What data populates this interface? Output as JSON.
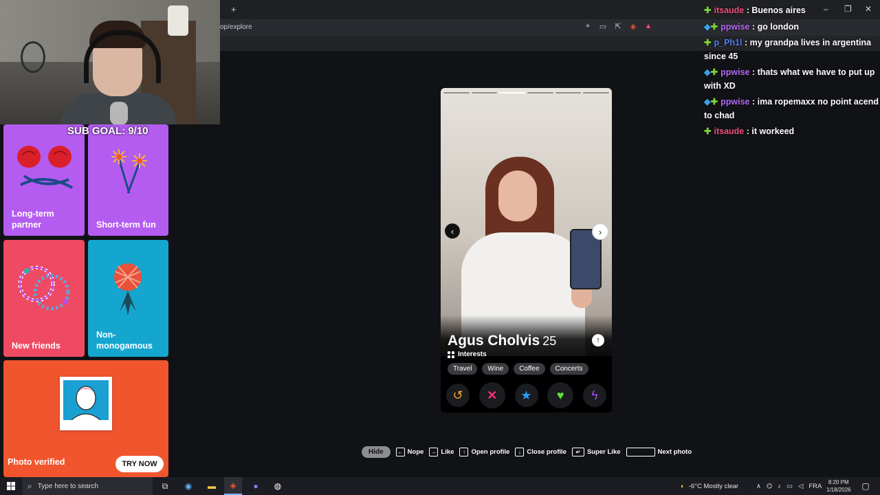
{
  "browser": {
    "new_tab": "+",
    "url": "op/explore",
    "window_controls": [
      "–",
      "❐",
      "✕"
    ]
  },
  "stream": {
    "sub_goal": "SUB GOAL: 9/10"
  },
  "cards": [
    {
      "label": "Long-term partner",
      "color": "#b45cf0"
    },
    {
      "label": "Short-term fun",
      "color": "#b45cf0"
    },
    {
      "label": "New friends",
      "color": "#ef4a63"
    },
    {
      "label": "Non-monogamous",
      "color": "#14a6cf"
    },
    {
      "label": "Photo verified",
      "color": "#f0552e",
      "button": "TRY NOW"
    }
  ],
  "profile": {
    "name": "Agus Cholvis",
    "age": "25",
    "interests_label": "Interests",
    "interests": [
      "Travel",
      "Wine",
      "Coffee",
      "Concerts"
    ],
    "photo_index": 3,
    "photo_count": 6
  },
  "actions": [
    "rewind-icon",
    "nope-icon",
    "super-like-icon",
    "like-icon",
    "boost-icon"
  ],
  "shortcuts": {
    "hide": "Hide",
    "nope": "Nope",
    "like": "Like",
    "open_profile": "Open profile",
    "close_profile": "Close profile",
    "super_like": "Super Like",
    "next_photo": "Next photo"
  },
  "chat": [
    {
      "user": "itsaude",
      "text": ": Buenos aires",
      "color": "#f04f7e"
    },
    {
      "user": "ppwise",
      "text": ": go london",
      "color": "#b56af5"
    },
    {
      "user": "p_Ph1l",
      "text": ": my grandpa lives in argentina since 45",
      "color": "#4f7ff5"
    },
    {
      "user": "ppwise",
      "text": ": thats what we have to put up with XD",
      "color": "#b56af5"
    },
    {
      "user": "ppwise",
      "text": ": ima ropemaxx no point acend to chad",
      "color": "#b56af5"
    },
    {
      "user": "itsaude",
      "text": ": it workeed",
      "color": "#f04f7e"
    }
  ],
  "taskbar": {
    "search_placeholder": "Type here to search",
    "weather": "-6°C  Mostly clear",
    "lang": "FRA",
    "time": "8:20 PM",
    "date": "1/18/2026"
  }
}
